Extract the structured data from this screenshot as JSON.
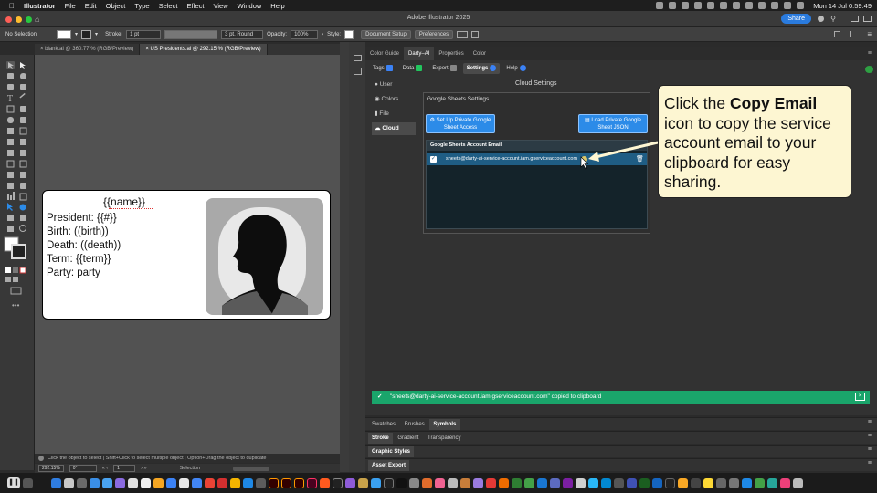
{
  "menubar": {
    "app": "Illustrator",
    "items": [
      "File",
      "Edit",
      "Object",
      "Type",
      "Select",
      "Effect",
      "View",
      "Window",
      "Help"
    ],
    "clock": "Mon 14 Jul  0:59:49"
  },
  "titlebar": {
    "title": "Adobe Illustrator 2025",
    "share": "Share"
  },
  "control": {
    "no_selection": "No Selection",
    "stroke_label": "Stroke:",
    "stroke_value": "1 pt",
    "brush": "3 pt. Round",
    "opacity_label": "Opacity:",
    "opacity_value": "100%",
    "style_label": "Style:",
    "doc_setup": "Document Setup",
    "preferences": "Preferences"
  },
  "doc_tabs": [
    {
      "label": "blank.ai @ 360.77 % (RGB/Preview)"
    },
    {
      "label": "US Presidents.ai @ 292.15 % (RGB/Preview)"
    }
  ],
  "artboard": {
    "name": "{{name}}",
    "lines": [
      "President: {{#}}",
      "Birth: ((birth))",
      "Death: ((death))",
      "Term: {{term}}",
      "Party: party"
    ]
  },
  "status": {
    "hint": "Click the object to select  |  Shift+Click to select multiple object  |  Option+Drag the object to duplicate",
    "zoom": "292.15%",
    "angle": "0°",
    "page": "1",
    "mode": "Selection"
  },
  "panel": {
    "tabs": [
      "Color Guide",
      "Darty–AI",
      "Properties",
      "Color"
    ],
    "active_tab": "Darty–AI",
    "sub_tabs": [
      {
        "label": "Tags",
        "color": "#3b82f6"
      },
      {
        "label": "Data",
        "color": "#22c55e"
      },
      {
        "label": "Export",
        "color": "#888888"
      },
      {
        "label": "Settings",
        "color": "#3b82f6"
      },
      {
        "label": "Help",
        "color": "#3b82f6"
      }
    ],
    "title": "Cloud Settings",
    "side_nav": [
      "User",
      "Colors",
      "File",
      "Cloud"
    ],
    "gs_title": "Google Sheets Settings",
    "btn_private": "Set Up Private Google Sheet Access",
    "btn_json": "Load Private Google Sheet JSON",
    "account_header": "Google Sheets Account Email",
    "account_email": "sheets@darty-ai-service-account.iam.gserviceaccount.com",
    "toast": "\"sheets@darty-ai-service-account.iam.gserviceaccount.com\" copied to clipboard"
  },
  "callout": {
    "pre": "Click the ",
    "bold": "Copy Email",
    "post": " icon to copy the service account email to your clipboard for easy sharing."
  },
  "lower_panels": {
    "row1": [
      "Swatches",
      "Brushes",
      "Symbols"
    ],
    "row2": [
      "Stroke",
      "Gradient",
      "Transparency"
    ],
    "graphic_styles": "Graphic Styles",
    "asset_export": "Asset Export"
  },
  "colors": {
    "accent": "#2c8be8",
    "toast": "#1aa56b",
    "callout_bg": "#fdf6d2",
    "row_selected": "#1f5d84"
  }
}
